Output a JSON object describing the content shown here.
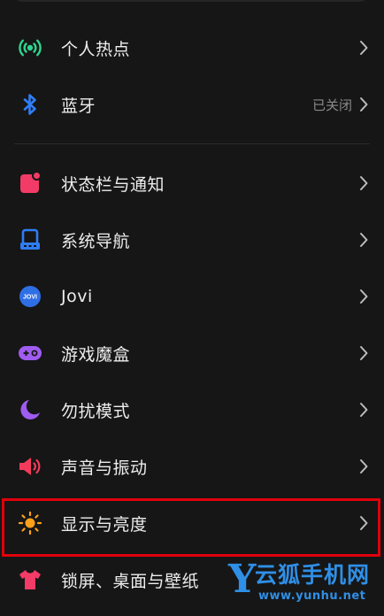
{
  "settings": {
    "items": [
      {
        "label": "个人热点",
        "icon": "hotspot-icon",
        "color": "#2fd48f"
      },
      {
        "label": "蓝牙",
        "value": "已关闭",
        "icon": "bluetooth-icon",
        "color": "#2f7df6"
      },
      {
        "label": "状态栏与通知",
        "icon": "status-bar-icon",
        "color": "#f23b66"
      },
      {
        "label": "系统导航",
        "icon": "navigation-icon",
        "color": "#2f7df6"
      },
      {
        "label": "Jovi",
        "icon": "jovi-icon",
        "icon_text": "JOVI",
        "color": "#2f6fe6"
      },
      {
        "label": "游戏魔盒",
        "icon": "game-controller-icon",
        "color": "#a05cf0"
      },
      {
        "label": "勿扰模式",
        "icon": "moon-icon",
        "color": "#a05cf0"
      },
      {
        "label": "声音与振动",
        "icon": "speaker-icon",
        "color": "#f23b5c"
      },
      {
        "label": "显示与亮度",
        "icon": "sun-icon",
        "color": "#ffa21a"
      },
      {
        "label": "锁屏、桌面与壁纸",
        "icon": "tshirt-icon",
        "color": "#f23b66"
      }
    ]
  },
  "highlight": {
    "color": "#e0000b",
    "target": "显示与亮度"
  },
  "watermark": {
    "letter": "Y",
    "name": "云狐手机网",
    "url": "www.yunhu.net",
    "color": "#2f8fe6"
  }
}
